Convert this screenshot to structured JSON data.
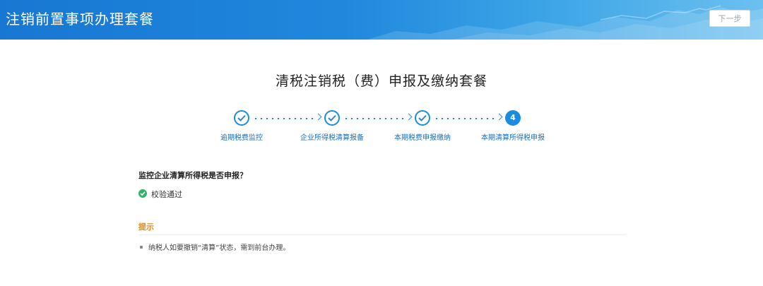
{
  "header": {
    "title": "注销前置事项办理套餐",
    "next_button": "下一步"
  },
  "main": {
    "title": "清税注销税（费）申报及缴纳套餐",
    "steps": [
      {
        "label": "逾期税费监控",
        "state": "done"
      },
      {
        "label": "企业所得税清算报备",
        "state": "done"
      },
      {
        "label": "本期税费申报缴纳",
        "state": "done"
      },
      {
        "label": "本期清算所得税申报",
        "state": "current",
        "number": "4"
      }
    ],
    "question": "监控企业清算所得税是否申报？",
    "check_result": "校验通过",
    "tip": {
      "title": "提示",
      "items": [
        "纳税人如要撤销“清算”状态，需到前台办理。"
      ]
    }
  },
  "colors": {
    "header_blue": "#1f88dd",
    "step_blue": "#1a8de2",
    "success_green": "#2fb36a",
    "tip_orange": "#e08a1c"
  }
}
